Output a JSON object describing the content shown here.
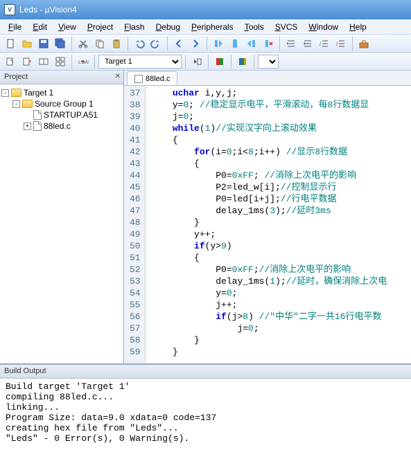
{
  "title": "Leds - µVision4",
  "menus": [
    "File",
    "Edit",
    "View",
    "Project",
    "Flash",
    "Debug",
    "Peripherals",
    "Tools",
    "SVCS",
    "Window",
    "Help"
  ],
  "target_combo": "Target 1",
  "project_panel_title": "Project",
  "tree": {
    "root": "Target 1",
    "group": "Source Group 1",
    "files": [
      "STARTUP.A51",
      "88led.c"
    ]
  },
  "tab": "88led.c",
  "lines": [
    {
      "n": 37,
      "indent": 4,
      "tokens": [
        {
          "t": "kw",
          "v": "uchar"
        },
        {
          "t": "id",
          "v": " i,y,j;"
        }
      ]
    },
    {
      "n": 38,
      "indent": 4,
      "tokens": [
        {
          "t": "id",
          "v": "y="
        },
        {
          "t": "num",
          "v": "0"
        },
        {
          "t": "id",
          "v": "; "
        },
        {
          "t": "cm",
          "v": "//稳定显示电平，平滑滚动，每8行数据显"
        }
      ]
    },
    {
      "n": 39,
      "indent": 4,
      "tokens": [
        {
          "t": "id",
          "v": "j="
        },
        {
          "t": "num",
          "v": "0"
        },
        {
          "t": "id",
          "v": ";"
        }
      ]
    },
    {
      "n": 40,
      "indent": 4,
      "tokens": [
        {
          "t": "kw",
          "v": "while"
        },
        {
          "t": "id",
          "v": "("
        },
        {
          "t": "num",
          "v": "1"
        },
        {
          "t": "id",
          "v": ")"
        },
        {
          "t": "cm",
          "v": "//实现汉字向上滚动效果"
        }
      ]
    },
    {
      "n": 41,
      "indent": 4,
      "tokens": [
        {
          "t": "id",
          "v": "{"
        }
      ]
    },
    {
      "n": 42,
      "indent": 8,
      "tokens": [
        {
          "t": "kw",
          "v": "for"
        },
        {
          "t": "id",
          "v": "(i="
        },
        {
          "t": "num",
          "v": "0"
        },
        {
          "t": "id",
          "v": ";i<"
        },
        {
          "t": "num",
          "v": "8"
        },
        {
          "t": "id",
          "v": ";i++) "
        },
        {
          "t": "cm",
          "v": "//显示8行数据"
        }
      ]
    },
    {
      "n": 43,
      "indent": 8,
      "tokens": [
        {
          "t": "id",
          "v": "{"
        }
      ]
    },
    {
      "n": 44,
      "indent": 12,
      "tokens": [
        {
          "t": "id",
          "v": "P0="
        },
        {
          "t": "num",
          "v": "0xFF"
        },
        {
          "t": "id",
          "v": "; "
        },
        {
          "t": "cm",
          "v": "//消除上次电平的影响"
        }
      ]
    },
    {
      "n": 45,
      "indent": 12,
      "tokens": [
        {
          "t": "id",
          "v": "P2=led_w[i];"
        },
        {
          "t": "cm",
          "v": "//控制显示行"
        }
      ]
    },
    {
      "n": 46,
      "indent": 12,
      "tokens": [
        {
          "t": "id",
          "v": "P0=led[i+j];"
        },
        {
          "t": "cm",
          "v": "//行电平数据"
        }
      ]
    },
    {
      "n": 47,
      "indent": 12,
      "tokens": [
        {
          "t": "id",
          "v": "delay_1ms("
        },
        {
          "t": "num",
          "v": "3"
        },
        {
          "t": "id",
          "v": ");"
        },
        {
          "t": "cm",
          "v": "//延时3ms"
        }
      ]
    },
    {
      "n": 48,
      "indent": 8,
      "tokens": [
        {
          "t": "id",
          "v": "}"
        }
      ]
    },
    {
      "n": 49,
      "indent": 8,
      "tokens": [
        {
          "t": "id",
          "v": "y++;"
        }
      ]
    },
    {
      "n": 50,
      "indent": 8,
      "tokens": [
        {
          "t": "kw",
          "v": "if"
        },
        {
          "t": "id",
          "v": "(y>"
        },
        {
          "t": "num",
          "v": "9"
        },
        {
          "t": "id",
          "v": ")"
        }
      ]
    },
    {
      "n": 51,
      "indent": 8,
      "tokens": [
        {
          "t": "id",
          "v": "{"
        }
      ]
    },
    {
      "n": 52,
      "indent": 12,
      "tokens": [
        {
          "t": "id",
          "v": "P0="
        },
        {
          "t": "num",
          "v": "0xFF"
        },
        {
          "t": "id",
          "v": ";"
        },
        {
          "t": "cm",
          "v": "//消除上次电平的影响"
        }
      ]
    },
    {
      "n": 53,
      "indent": 12,
      "tokens": [
        {
          "t": "id",
          "v": "delay_1ms("
        },
        {
          "t": "num",
          "v": "1"
        },
        {
          "t": "id",
          "v": ");"
        },
        {
          "t": "cm",
          "v": "//延时，确保消除上次电"
        }
      ]
    },
    {
      "n": 54,
      "indent": 12,
      "tokens": [
        {
          "t": "id",
          "v": "y="
        },
        {
          "t": "num",
          "v": "0"
        },
        {
          "t": "id",
          "v": ";"
        }
      ]
    },
    {
      "n": 55,
      "indent": 12,
      "tokens": [
        {
          "t": "id",
          "v": "j++;"
        }
      ]
    },
    {
      "n": 56,
      "indent": 12,
      "tokens": [
        {
          "t": "kw",
          "v": "if"
        },
        {
          "t": "id",
          "v": "(j>"
        },
        {
          "t": "num",
          "v": "8"
        },
        {
          "t": "id",
          "v": ") "
        },
        {
          "t": "cm",
          "v": "//\"中华\"二字一共16行电平数"
        }
      ]
    },
    {
      "n": 57,
      "indent": 16,
      "tokens": [
        {
          "t": "id",
          "v": "j="
        },
        {
          "t": "num",
          "v": "0"
        },
        {
          "t": "id",
          "v": ";"
        }
      ]
    },
    {
      "n": 58,
      "indent": 8,
      "tokens": [
        {
          "t": "id",
          "v": "}"
        }
      ]
    },
    {
      "n": 59,
      "indent": 4,
      "tokens": [
        {
          "t": "id",
          "v": "}"
        }
      ]
    }
  ],
  "output_title": "Build Output",
  "output_lines": [
    "Build target 'Target 1'",
    "compiling 88led.c...",
    "linking...",
    "Program Size: data=9.0 xdata=0 code=137",
    "creating hex file from \"Leds\"...",
    "\"Leds\" - 0 Error(s), 0 Warning(s)."
  ]
}
